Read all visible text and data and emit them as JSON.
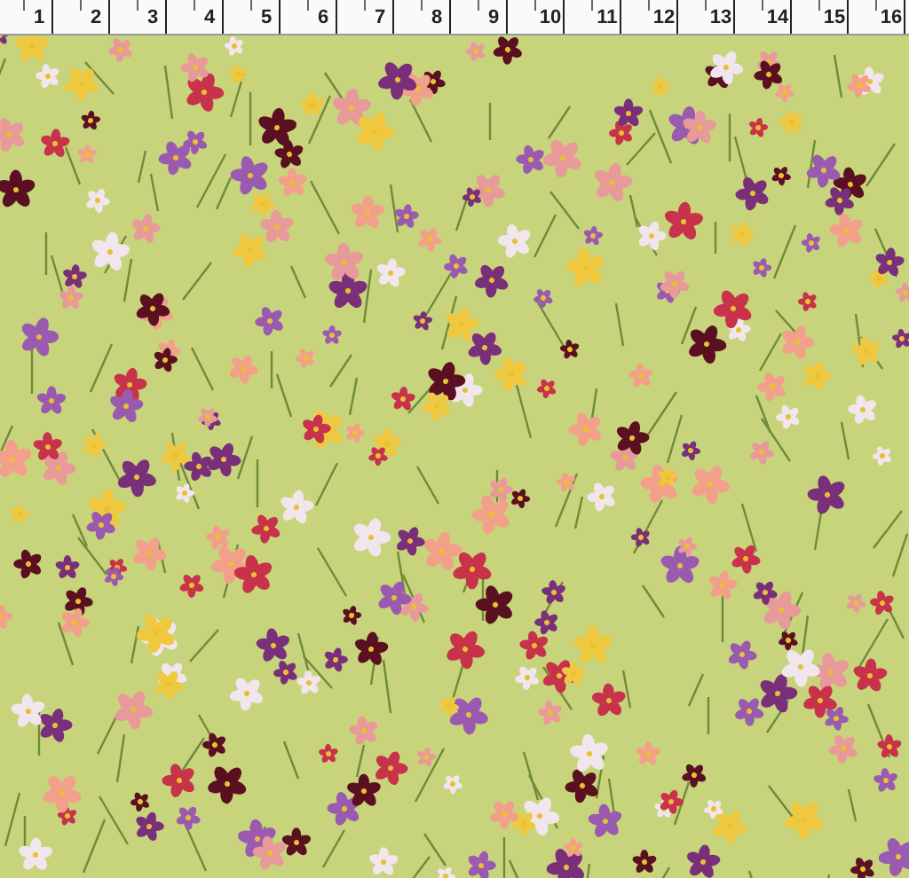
{
  "ruler": {
    "labels": [
      "1",
      "2",
      "3",
      "4",
      "5",
      "6",
      "7",
      "8",
      "9",
      "10",
      "11",
      "12",
      "13",
      "14",
      "15",
      "16"
    ]
  }
}
